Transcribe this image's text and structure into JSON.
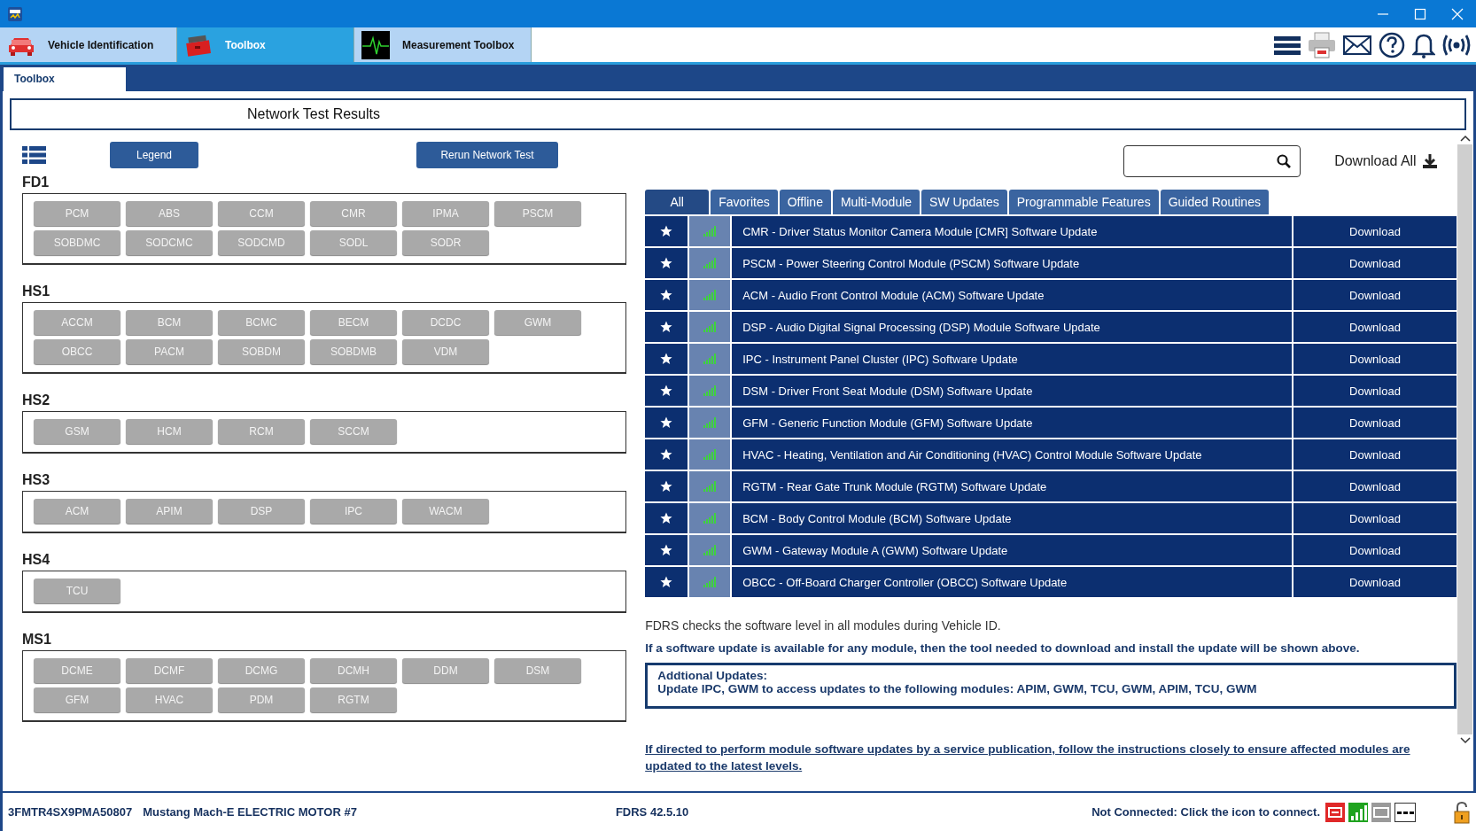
{
  "app_tabs": [
    {
      "label": "Vehicle Identification",
      "selected": false
    },
    {
      "label": "Toolbox",
      "selected": true
    },
    {
      "label": "Measurement Toolbox",
      "selected": false
    }
  ],
  "sub_tabs": [
    {
      "label": "Toolbox",
      "selected": true
    }
  ],
  "header": {
    "title": "Network Test Results"
  },
  "network": {
    "buttons": [
      "Legend",
      "Rerun Network Test"
    ],
    "buses": [
      {
        "name": "FD1",
        "modules": [
          "PCM",
          "ABS",
          "CCM",
          "CMR",
          "IPMA",
          "PSCM",
          "SOBDMC",
          "SODCMC",
          "SODCMD",
          "SODL",
          "SODR"
        ]
      },
      {
        "name": "HS1",
        "modules": [
          "ACCM",
          "BCM",
          "BCMC",
          "BECM",
          "DCDC",
          "GWM",
          "OBCC",
          "PACM",
          "SOBDM",
          "SOBDMB",
          "VDM"
        ]
      },
      {
        "name": "HS2",
        "modules": [
          "GSM",
          "HCM",
          "RCM",
          "SCCM"
        ]
      },
      {
        "name": "HS3",
        "modules": [
          "ACM",
          "APIM",
          "DSP",
          "IPC",
          "WACM"
        ]
      },
      {
        "name": "HS4",
        "modules": [
          "TCU"
        ]
      },
      {
        "name": "MS1",
        "modules": [
          "DCME",
          "DCMF",
          "DCMG",
          "DCMH",
          "DDM",
          "DSM",
          "GFM",
          "HVAC",
          "PDM",
          "RGTM"
        ]
      }
    ]
  },
  "download_all": "Download All",
  "filter_tabs": [
    {
      "label": "All",
      "selected": true
    },
    {
      "label": "Favorites",
      "selected": false
    },
    {
      "label": "Offline",
      "selected": false
    },
    {
      "label": "Multi-Module",
      "selected": false
    },
    {
      "label": "SW Updates",
      "selected": false
    },
    {
      "label": "Programmable Features",
      "selected": false
    },
    {
      "label": "Guided Routines",
      "selected": false
    }
  ],
  "updates": [
    {
      "title": "CMR - Driver Status Monitor Camera Module [CMR] Software Update",
      "action": "Download"
    },
    {
      "title": "PSCM - Power Steering Control Module (PSCM) Software Update",
      "action": "Download"
    },
    {
      "title": "ACM - Audio Front Control Module (ACM) Software Update",
      "action": "Download"
    },
    {
      "title": "DSP - Audio Digital Signal Processing (DSP) Module Software Update",
      "action": "Download"
    },
    {
      "title": "IPC - Instrument Panel Cluster (IPC) Software Update",
      "action": "Download"
    },
    {
      "title": "DSM - Driver Front Seat Module (DSM) Software Update",
      "action": "Download"
    },
    {
      "title": "GFM - Generic Function Module (GFM) Software Update",
      "action": "Download"
    },
    {
      "title": "HVAC - Heating, Ventilation and Air Conditioning (HVAC) Control Module Software Update",
      "action": "Download"
    },
    {
      "title": "RGTM - Rear Gate Trunk Module (RGTM) Software Update",
      "action": "Download"
    },
    {
      "title": "BCM - Body Control Module (BCM) Software Update",
      "action": "Download"
    },
    {
      "title": "GWM - Gateway Module A (GWM) Software Update",
      "action": "Download"
    },
    {
      "title": "OBCC - Off-Board Charger Controller (OBCC) Software Update",
      "action": "Download"
    }
  ],
  "notes": {
    "info": "FDRS checks the software level in all modules during Vehicle ID.",
    "notice": "If a software update is available for any module, then the tool needed to download and install the update will be shown above.",
    "additional_title": "Addtional Updates:",
    "additional_text": "Update IPC, GWM to access updates to the following modules: APIM, GWM, TCU, GWM, APIM, TCU, GWM",
    "link": "If directed to perform module software updates by a service publication, follow the instructions closely to ensure affected modules are updated to the latest levels."
  },
  "status_bar": {
    "vin": "3FMTR4SX9PMA50807",
    "vehicle": "Mustang Mach-E ELECTRIC MOTOR #7",
    "version": "FDRS 42.5.10",
    "connection": "Not Connected: Click the icon to connect."
  }
}
